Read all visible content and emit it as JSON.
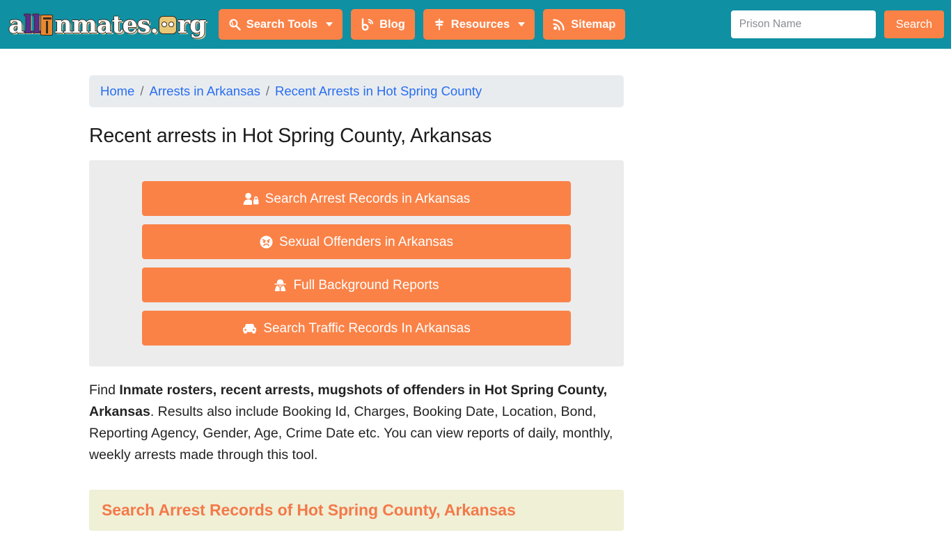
{
  "site": {
    "logo_text_parts": [
      "a",
      "ll",
      "i",
      "nmates",
      ".",
      "o",
      "rg"
    ],
    "logo_alt": "allinmates.org"
  },
  "navbar": {
    "background_color": "#0f90a3",
    "accent_color": "#fa8247",
    "items": [
      {
        "label": "Search Tools",
        "icon": "search-icon",
        "has_caret": true
      },
      {
        "label": "Blog",
        "icon": "blog-icon",
        "has_caret": false
      },
      {
        "label": "Resources",
        "icon": "leaf-icon",
        "has_caret": true
      },
      {
        "label": "Sitemap",
        "icon": "rss-icon",
        "has_caret": false
      }
    ],
    "search": {
      "placeholder": "Prison Name",
      "value": "",
      "button_label": "Search"
    }
  },
  "breadcrumb": {
    "separator": "/",
    "items": [
      {
        "label": "Home"
      },
      {
        "label": "Arrests in Arkansas"
      },
      {
        "label": "Recent Arrests in Hot Spring County"
      }
    ]
  },
  "main": {
    "page_title": "Recent arrests in Hot Spring County, Arkansas",
    "action_buttons": [
      {
        "label": "Search Arrest Records in Arkansas",
        "icon": "user-lock-icon"
      },
      {
        "label": "Sexual Offenders in Arkansas",
        "icon": "angry-face-icon"
      },
      {
        "label": "Full Background Reports",
        "icon": "user-secret-icon"
      },
      {
        "label": "Search Traffic Records In Arkansas",
        "icon": "car-icon"
      }
    ],
    "description": {
      "lead": "Find ",
      "bold": "Inmate rosters, recent arrests, mugshots of offenders in Hot Spring County, Arkansas",
      "rest": ". Results also include Booking Id, Charges, Booking Date, Location, Bond, Reporting Agency, Gender, Age, Crime Date etc. You can view reports of daily, monthly, weekly arrests made through this tool."
    },
    "section_banner": {
      "heading": "Search Arrest Records of Hot Spring County, Arkansas",
      "background_color": "#eff0d6",
      "text_color": "#f4794a"
    }
  }
}
